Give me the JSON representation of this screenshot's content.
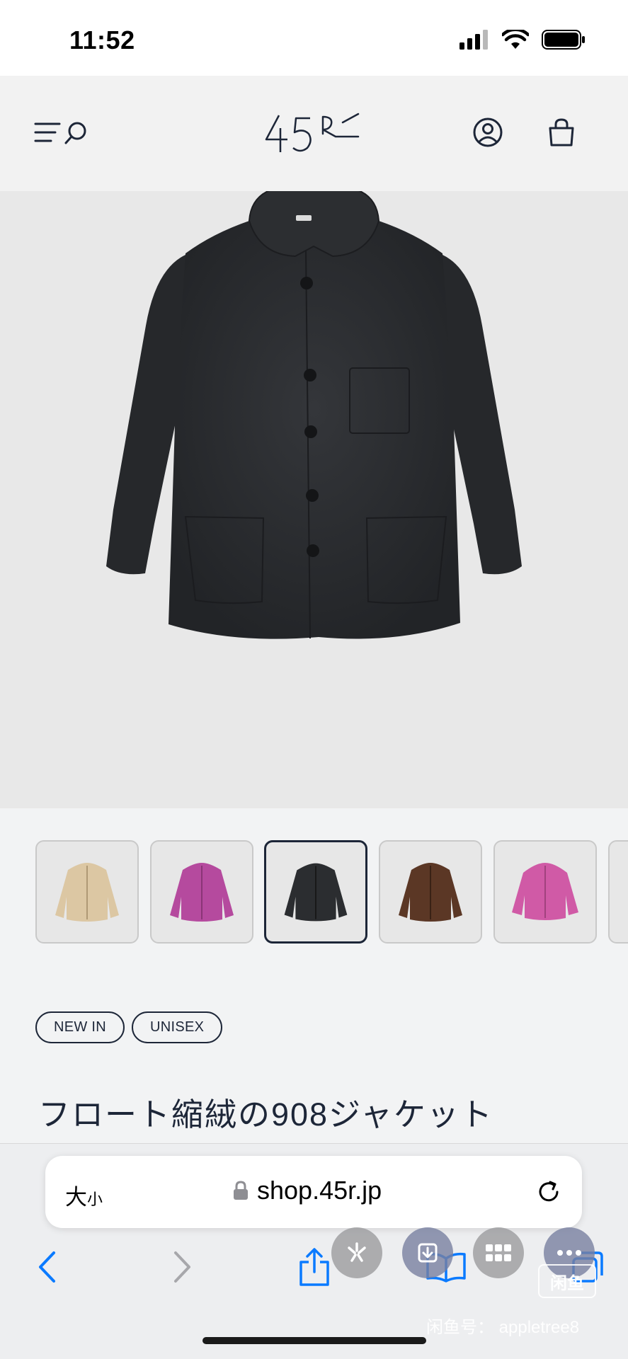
{
  "status_bar": {
    "time": "11:52"
  },
  "header": {
    "logo": "45R"
  },
  "thumbnails": [
    {
      "color": "#dcc7a3",
      "label": "beige"
    },
    {
      "color": "#b54a9e",
      "label": "magenta"
    },
    {
      "color": "#2b2d30",
      "label": "charcoal",
      "selected": true
    },
    {
      "color": "#5b3725",
      "label": "brown"
    },
    {
      "color": "#d05aa6",
      "label": "pink"
    }
  ],
  "tags": [
    "NEW IN",
    "UNISEX"
  ],
  "product": {
    "title": "フロート縮絨の908ジャケット"
  },
  "browser": {
    "text_size_label": "大",
    "text_size_small": "小",
    "url": "shop.45r.jp"
  },
  "watermark": {
    "badge": "闲鱼",
    "text": "闲鱼号： appletree8"
  },
  "colors": {
    "navy": "#1d2638",
    "jacket": "#2b2d30",
    "ios_blue": "#0a7aff"
  }
}
